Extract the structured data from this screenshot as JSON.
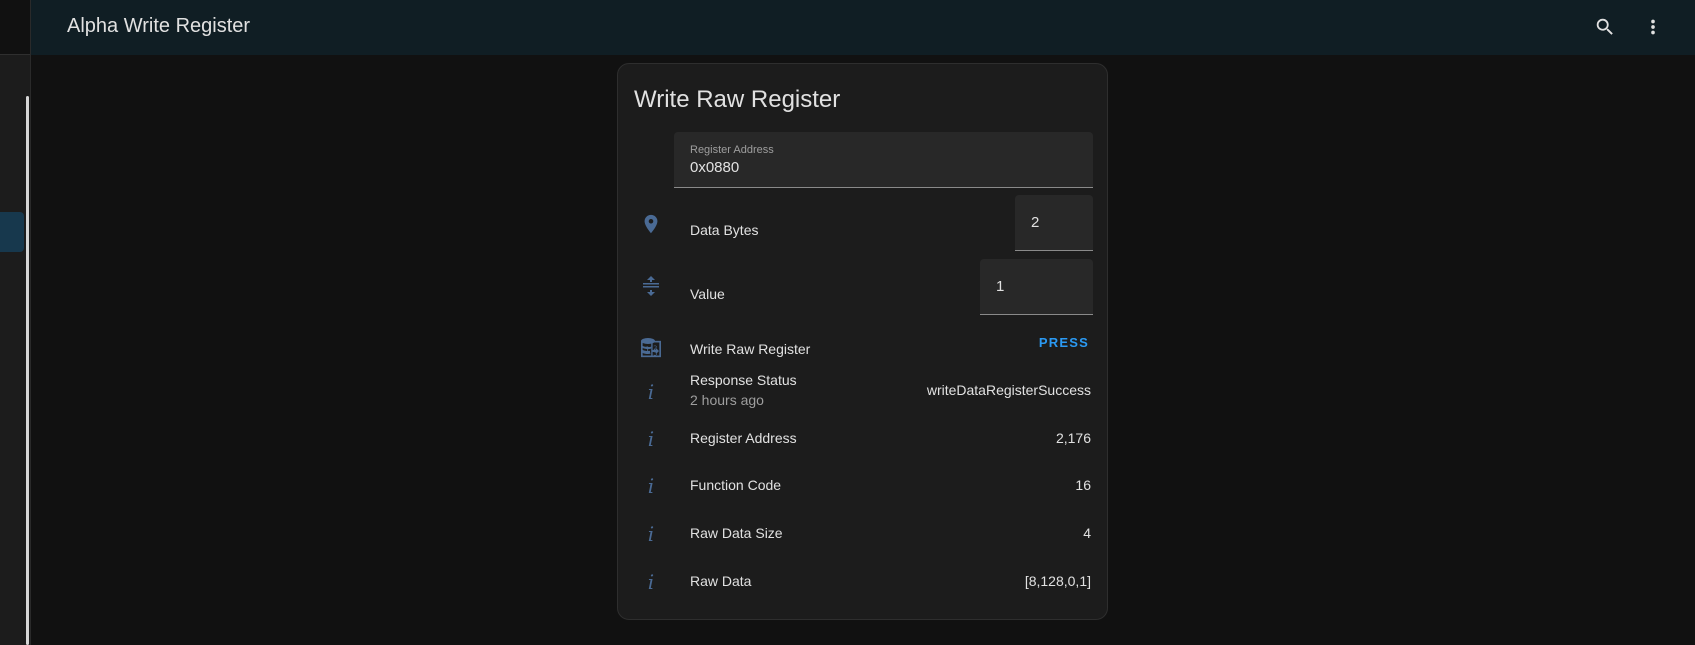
{
  "header": {
    "title": "Alpha Write Register",
    "search_icon": "search-icon",
    "menu_icon": "dots-vertical-icon"
  },
  "card": {
    "title": "Write Raw Register",
    "register_address_field": {
      "label": "Register Address",
      "value": "0x0880",
      "icon": "map-marker-icon"
    },
    "data_bytes": {
      "label": "Data Bytes",
      "value": "2",
      "icon": "arrow-collapse-vertical-icon"
    },
    "value_field": {
      "label": "Value",
      "value": "1",
      "icon": "numeric-box-icon"
    },
    "write_button_row": {
      "label": "Write Raw Register",
      "button_label": "PRESS",
      "icon": "database-export-icon"
    },
    "sensors": [
      {
        "label": "Response Status",
        "secondary": "2 hours ago",
        "value": "writeDataRegisterSuccess",
        "icon": "information-icon"
      },
      {
        "label": "Register Address",
        "value": "2,176",
        "icon": "information-icon"
      },
      {
        "label": "Function Code",
        "value": "16",
        "icon": "information-icon"
      },
      {
        "label": "Raw Data Size",
        "value": "4",
        "icon": "information-icon"
      },
      {
        "label": "Raw Data",
        "value": "[8,128,0,1]",
        "icon": "information-icon"
      }
    ]
  },
  "colors": {
    "accent": "#2b9af3",
    "icon": "#4a6a94",
    "background": "#111111",
    "card": "#1c1c1c",
    "header": "#101e24"
  }
}
